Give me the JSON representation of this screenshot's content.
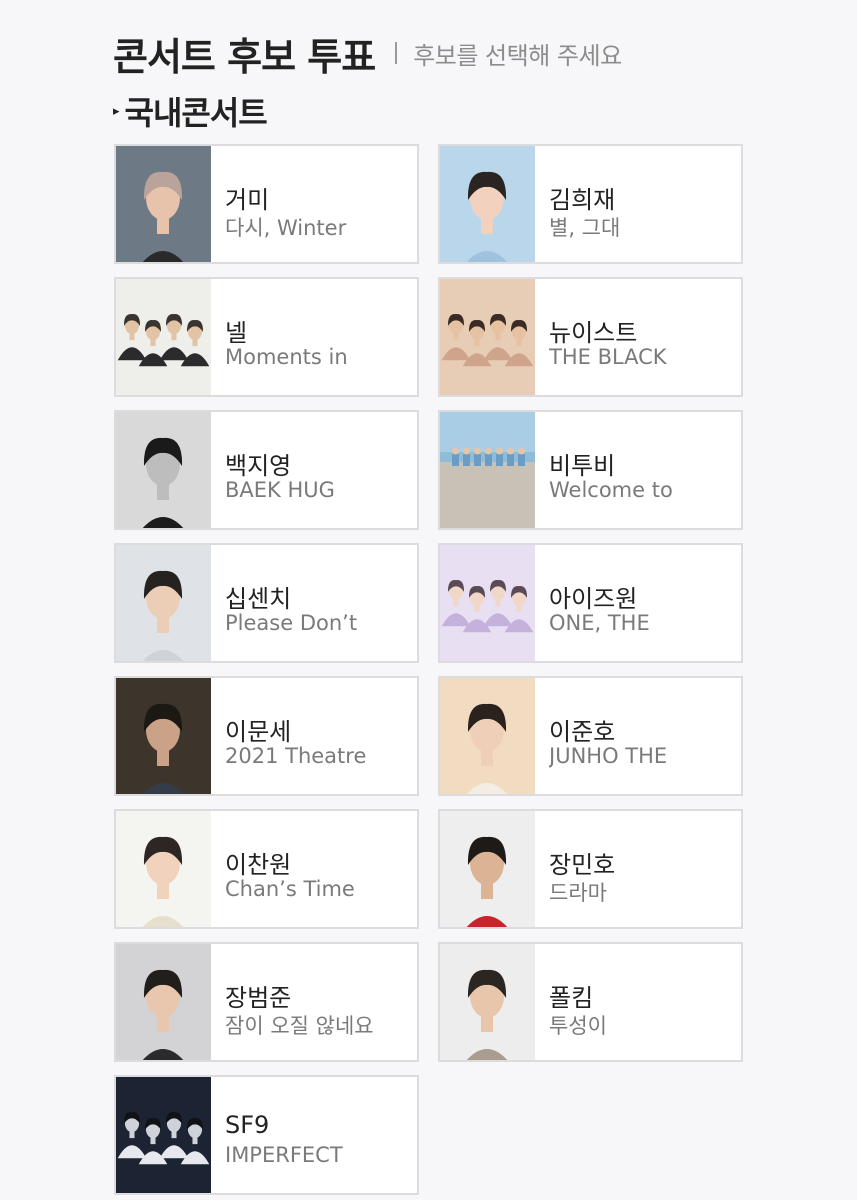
{
  "header": {
    "title": "콘서트 후보 투표",
    "subtitle": "후보를 선택해 주세요"
  },
  "section": {
    "icon": "chevron-bullet-icon",
    "title": "국내콘서트"
  },
  "candidates": [
    {
      "name": "거미",
      "concert": "다시, Winter",
      "bg": "#6d7a86",
      "skin": "#e8c3ab",
      "cloth": "#2a2a2a",
      "hair": "#b9a39a",
      "photo_type": "solo"
    },
    {
      "name": "김희재",
      "concert": "별, 그대",
      "bg": "#b9d6ea",
      "skin": "#f2d2bf",
      "cloth": "#9fc2de",
      "hair": "#2a2522",
      "photo_type": "solo"
    },
    {
      "name": "넬",
      "concert": "Moments in",
      "bg": "#eeeeea",
      "skin": "#e3c3a6",
      "cloth": "#2b2b2e",
      "hair": "#3a3430",
      "photo_type": "group"
    },
    {
      "name": "뉴이스트",
      "concert": "THE BLACK",
      "bg": "#e7cdb6",
      "skin": "#e6c2a3",
      "cloth": "#d0a48b",
      "hair": "#3a2c25",
      "photo_type": "group"
    },
    {
      "name": "백지영",
      "concert": "BAEK HUG",
      "bg": "#d9d9d9",
      "skin": "#bdbdbd",
      "cloth": "#1c1c1c",
      "hair": "#1a1a1a",
      "photo_type": "solo"
    },
    {
      "name": "비투비",
      "concert": "Welcome to",
      "bg": "#c7c1b6",
      "skin": "#e2c6ac",
      "cloth": "#6a9cc6",
      "hair": "#3b332d",
      "photo_type": "beach"
    },
    {
      "name": "십센치",
      "concert": "Please Don’t",
      "bg": "#dfe3e8",
      "skin": "#eccdb6",
      "cloth": "#cfd3d8",
      "hair": "#252220",
      "photo_type": "solo"
    },
    {
      "name": "아이즈원",
      "concert": "ONE, THE",
      "bg": "#e8dff2",
      "skin": "#f0d7c8",
      "cloth": "#c4b2dd",
      "hair": "#5a4a55",
      "photo_type": "group"
    },
    {
      "name": "이문세",
      "concert": "2021 Theatre",
      "bg": "#3d342c",
      "skin": "#c9a287",
      "cloth": "#343c4a",
      "hair": "#1c1814",
      "photo_type": "solo"
    },
    {
      "name": "이준호",
      "concert": "JUNHO THE",
      "bg": "#f1dcc2",
      "skin": "#efcfb7",
      "cloth": "#f4ede3",
      "hair": "#2a221d",
      "photo_type": "solo"
    },
    {
      "name": "이찬원",
      "concert": "Chan’s Time",
      "bg": "#f4f4f0",
      "skin": "#f0d2bd",
      "cloth": "#e7dfcd",
      "hair": "#2d2622",
      "photo_type": "solo"
    },
    {
      "name": "장민호",
      "concert": "드라마",
      "bg": "#eeeeee",
      "skin": "#dcb394",
      "cloth": "#c9242b",
      "hair": "#1d1a18",
      "photo_type": "solo"
    },
    {
      "name": "장범준",
      "concert": "잠이 오질 않네요",
      "bg": "#d3d3d6",
      "skin": "#e9c7ae",
      "cloth": "#2b2b2d",
      "hair": "#221e1c",
      "photo_type": "solo"
    },
    {
      "name": "폴킴",
      "concert": "투성이",
      "bg": "#ededed",
      "skin": "#e8c6ac",
      "cloth": "#a99d90",
      "hair": "#2c2622",
      "photo_type": "solo"
    },
    {
      "name": "SF9",
      "concert": "IMPERFECT",
      "bg": "#1c2434",
      "skin": "#cfd2d8",
      "cloth": "#e6e8ee",
      "hair": "#101216",
      "photo_type": "group"
    }
  ]
}
